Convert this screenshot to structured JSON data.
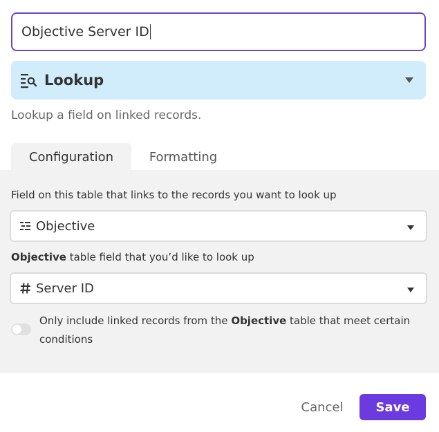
{
  "field_name": {
    "value": "Objective Server ID"
  },
  "field_type": {
    "label": "Lookup",
    "icon": "lookup-icon"
  },
  "description": "Lookup a field on linked records.",
  "tabs": [
    {
      "label": "Configuration",
      "active": true
    },
    {
      "label": "Formatting",
      "active": false
    }
  ],
  "config": {
    "link_field_label": "Field on this table that links to the records you want to look up",
    "link_field_value": "Objective",
    "link_field_icon": "link-list-icon",
    "lookup_label_bold": "Objective",
    "lookup_label_rest": " table field that you’d like to look up",
    "lookup_field_value": "Server ID",
    "lookup_field_icon": "hash-icon",
    "condition_toggle": {
      "on": false,
      "text_before": "Only include linked records from the ",
      "text_bold": "Objective",
      "text_after": " table that meet certain conditions"
    }
  },
  "actions": {
    "cancel_label": "Cancel",
    "save_label": "Save"
  },
  "colors": {
    "accent": "#6b3be0",
    "focus_border": "#6b46c1",
    "type_bg": "#d1ecfb",
    "panel_bg": "#f2f2f2"
  }
}
